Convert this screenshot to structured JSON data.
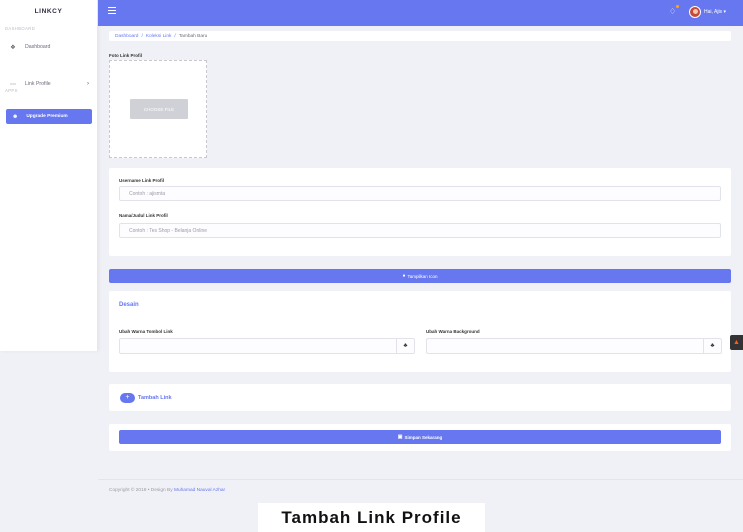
{
  "sidebar": {
    "brand": "LINKCY",
    "section_dashboard": "DASHBOARD",
    "section_apps": "APPS",
    "items": [
      {
        "label": "Dashboard",
        "icon": "home-icon"
      },
      {
        "label": "Link Profile",
        "icon": "dots-icon"
      }
    ],
    "upgrade_label": "Upgrade Premium"
  },
  "topbar": {
    "user_greeting": "Hai, Ajis ▾"
  },
  "breadcrumb": {
    "items": [
      "Dashboard",
      "Koleksi Link",
      "Tambah Baru"
    ]
  },
  "photo": {
    "label": "Foto Link Profil",
    "choose_label": "CHOOSE FILE"
  },
  "form": {
    "username_label": "Username Link Profil",
    "username_placeholder": "Contoh : ajismta",
    "nama_label": "Nama/Judul Link Profil",
    "nama_placeholder": "Contoh : Tes Shop - Belanja Online"
  },
  "show_icon_label": "Tampilkan Icon",
  "desain": {
    "title": "Desain",
    "tombol_label": "Ubah Warna Tombol Link",
    "bg_label": "Ubah Warna Background"
  },
  "tambah_link_label": "Tambah Link",
  "simpan_label": "Simpan Sekarang",
  "footer": {
    "prefix": "Copyright © 2018 • Design By",
    "author": "Muhamad Nauval Azhar"
  },
  "caption": "Tambah Link Profile",
  "colors": {
    "primary": "#6777ef",
    "background": "#f0f1f6"
  }
}
